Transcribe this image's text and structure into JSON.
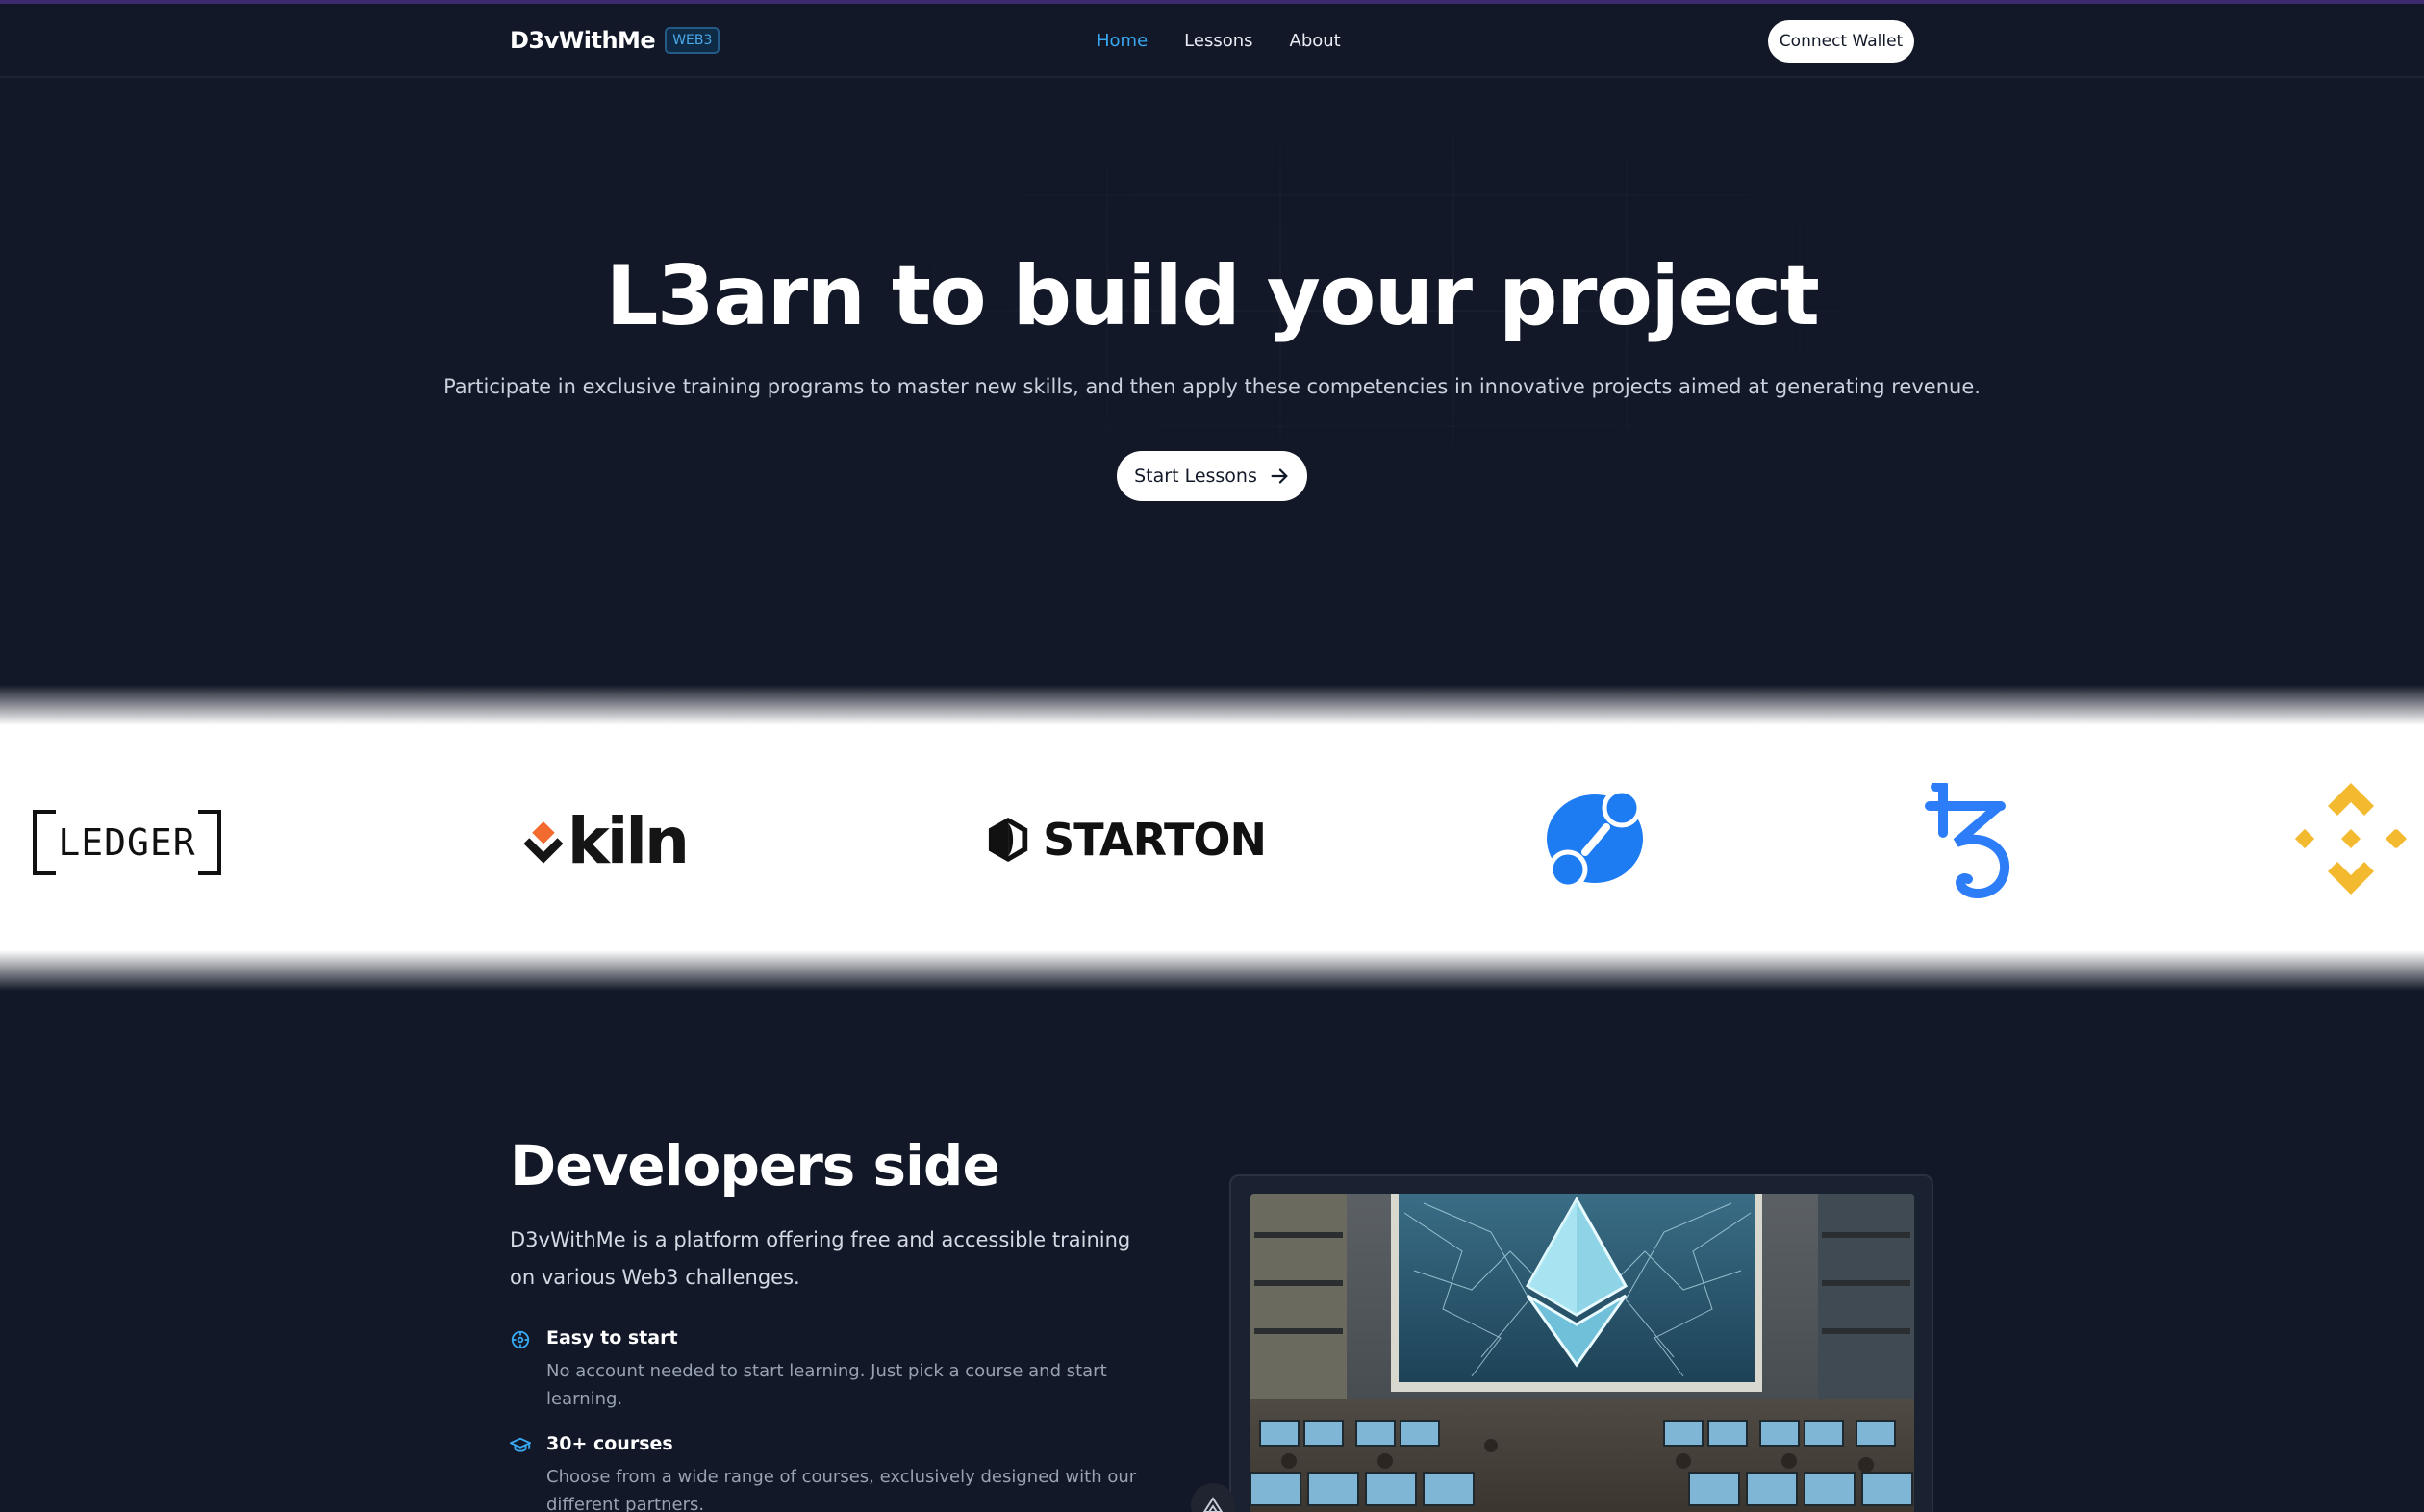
{
  "header": {
    "brand": "D3vWithMe",
    "badge": "WEB3",
    "nav": [
      {
        "label": "Home",
        "active": true
      },
      {
        "label": "Lessons",
        "active": false
      },
      {
        "label": "About",
        "active": false
      }
    ],
    "connect_label": "Connect Wallet"
  },
  "hero": {
    "title": "L3arn to build your project",
    "subtitle": "Participate in exclusive training programs to master new skills, and then apply these competencies in innovative projects aimed at generating revenue.",
    "cta_label": "Start Lessons",
    "cta_icon": "arrow-right-icon"
  },
  "partners": {
    "logos": [
      {
        "name": "ledger",
        "text": "LEDGER"
      },
      {
        "name": "kiln",
        "text": "kiln"
      },
      {
        "name": "starton",
        "text": "STARTON"
      },
      {
        "name": "chainlink",
        "text": ""
      },
      {
        "name": "tezos",
        "text": ""
      },
      {
        "name": "binance",
        "text": ""
      }
    ]
  },
  "developers": {
    "title": "Developers side",
    "description": "D3vWithMe is a platform offering free and accessible training on various Web3 challenges.",
    "features": [
      {
        "icon": "compass-icon",
        "title": "Easy to start",
        "text": "No account needed to start learning. Just pick a course and start learning."
      },
      {
        "icon": "graduation-cap-icon",
        "title": "30+ courses",
        "text": "Choose from a wide range of courses, exclusively designed with our different partners."
      }
    ]
  },
  "colors": {
    "background": "#121827",
    "accent": "#38a9f2",
    "badge": "#235a86",
    "kiln_orange": "#f26a2e",
    "chainlink_blue": "#1e7cf2",
    "tezos_blue": "#2c7df7",
    "binance_yellow": "#f3ba2f"
  }
}
